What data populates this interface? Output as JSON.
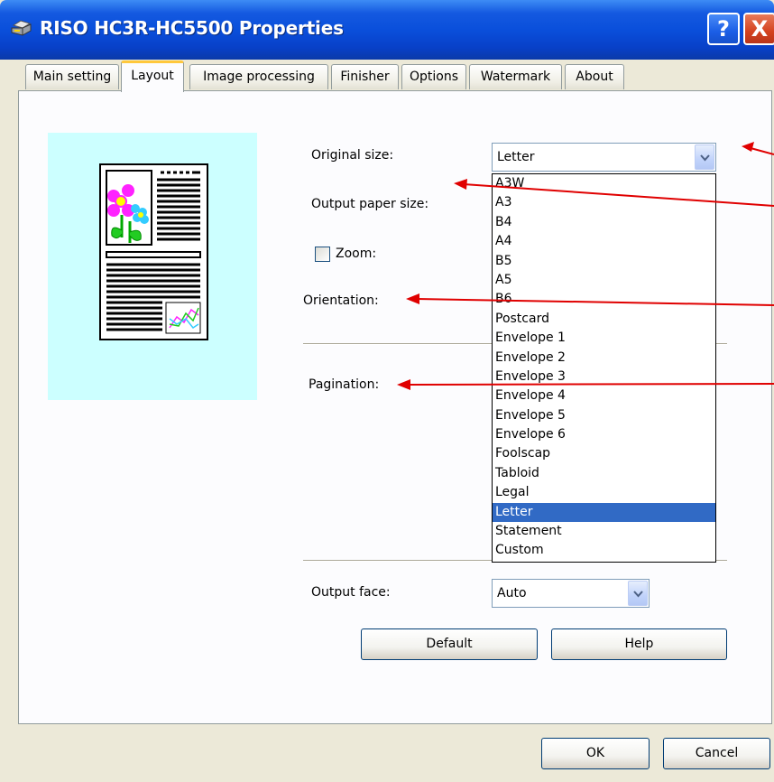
{
  "window": {
    "title": "RISO HC3R-HC5500 Properties",
    "help_label": "?",
    "close_label": "X"
  },
  "tabs": [
    {
      "label": "Main setting",
      "active": false
    },
    {
      "label": "Layout",
      "active": true
    },
    {
      "label": "Image processing",
      "active": false
    },
    {
      "label": "Finisher",
      "active": false
    },
    {
      "label": "Options",
      "active": false
    },
    {
      "label": "Watermark",
      "active": false
    },
    {
      "label": "About",
      "active": false
    }
  ],
  "layout": {
    "original_size_label": "Original size:",
    "original_size_value": "Letter",
    "output_paper_size_label": "Output paper size:",
    "zoom_label": "Zoom:",
    "zoom_checked": false,
    "orientation_label": "Orientation:",
    "pagination_label": "Pagination:",
    "output_face_label": "Output face:",
    "output_face_value": "Auto",
    "default_button": "Default",
    "help_button": "Help"
  },
  "dropdown": {
    "options": [
      "A3W",
      "A3",
      "B4",
      "A4",
      "B5",
      "A5",
      "B6",
      "Postcard",
      "Envelope 1",
      "Envelope 2",
      "Envelope 3",
      "Envelope 4",
      "Envelope 5",
      "Envelope 6",
      "Foolscap",
      "Tabloid",
      "Legal",
      "Letter",
      "Statement",
      "Custom"
    ],
    "selected": "Letter"
  },
  "footer": {
    "ok_button": "OK",
    "cancel_button": "Cancel"
  },
  "colors": {
    "titlebar": "#0a4fdb",
    "selection": "#316ac5",
    "preview_bg": "#ccffff",
    "annotation_arrow": "#e00000",
    "active_tab_accent": "#ffc83c"
  }
}
